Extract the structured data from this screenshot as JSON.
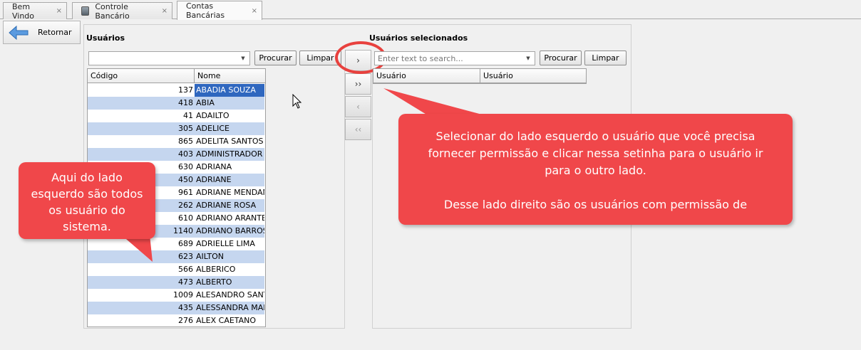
{
  "tabs": [
    {
      "label": "Bem Vindo",
      "close": "×"
    },
    {
      "label": "Controle Bancário",
      "close": "×"
    },
    {
      "label": "Contas Bancárias",
      "close": "×"
    }
  ],
  "toolbar": {
    "return_label": "Retornar"
  },
  "left": {
    "title": "Usuários",
    "search_value": "",
    "search_label": "Procurar",
    "clear_label": "Limpar",
    "col_code": "Código",
    "col_name": "Nome",
    "rows": [
      {
        "code": "137",
        "name": "ABADIA SOUZA"
      },
      {
        "code": "418",
        "name": "ABIA"
      },
      {
        "code": "41",
        "name": "ADAILTO"
      },
      {
        "code": "305",
        "name": "ADELICE"
      },
      {
        "code": "865",
        "name": "ADELITA SANTOS"
      },
      {
        "code": "403",
        "name": "ADMINISTRADOR"
      },
      {
        "code": "630",
        "name": "ADRIANA"
      },
      {
        "code": "450",
        "name": "ADRIANE"
      },
      {
        "code": "961",
        "name": "ADRIANE MENDAN"
      },
      {
        "code": "262",
        "name": "ADRIANE ROSA"
      },
      {
        "code": "610",
        "name": "ADRIANO ARANTE"
      },
      {
        "code": "1140",
        "name": "ADRIANO BARROS"
      },
      {
        "code": "689",
        "name": "ADRIELLE LIMA"
      },
      {
        "code": "623",
        "name": "AILTON"
      },
      {
        "code": "566",
        "name": "ALBERICO"
      },
      {
        "code": "473",
        "name": "ALBERTO"
      },
      {
        "code": "1009",
        "name": "ALESANDRO SANT"
      },
      {
        "code": "435",
        "name": "ALESSANDRA MAL"
      },
      {
        "code": "276",
        "name": "ALEX CAETANO"
      }
    ]
  },
  "middle": {
    "add_one": "›",
    "add_all": "››",
    "remove_one": "‹",
    "remove_all": "‹‹"
  },
  "right": {
    "title": "Usuários selecionados",
    "search_placeholder": "Enter text to search...",
    "search_label": "Procurar",
    "clear_label": "Limpar",
    "col1": "Usuário",
    "col2": "Usuário"
  },
  "callouts": {
    "left_lines": [
      "Aqui do lado",
      "esquerdo são todos",
      "os usuário do",
      "sistema."
    ],
    "right_lines": [
      "Selecionar do lado esquerdo o usuário que você precisa",
      "fornecer permissão e clicar nessa setinha para o usuário ir",
      "para o outro lado.",
      "",
      "Desse lado direito são os usuários com permissão de"
    ]
  },
  "colors": {
    "selection": "#2f67bf",
    "row_alt": "#c5d6ef",
    "callout": "#f0474a"
  }
}
